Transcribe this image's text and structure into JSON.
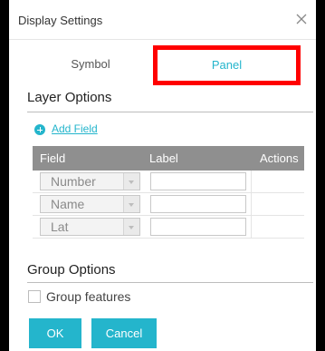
{
  "dialog": {
    "title": "Display Settings",
    "close_icon": "close-x-icon"
  },
  "tabs": [
    {
      "label": "Symbol",
      "active": false
    },
    {
      "label": "Panel",
      "active": true
    }
  ],
  "layer_options": {
    "title": "Layer Options",
    "add_field_label": "Add Field",
    "columns": [
      "Field",
      "Label",
      "Actions"
    ],
    "rows": [
      {
        "field": "Number",
        "label": ""
      },
      {
        "field": "Name",
        "label": ""
      },
      {
        "field": "Lat",
        "label": ""
      }
    ]
  },
  "group_options": {
    "title": "Group Options",
    "group_features_label": "Group features",
    "group_features_checked": false
  },
  "buttons": {
    "ok_label": "OK",
    "cancel_label": "Cancel"
  },
  "colors": {
    "accent": "#24b5cc",
    "highlight_border": "#ff0000",
    "header_bg": "#8f8f8f"
  }
}
